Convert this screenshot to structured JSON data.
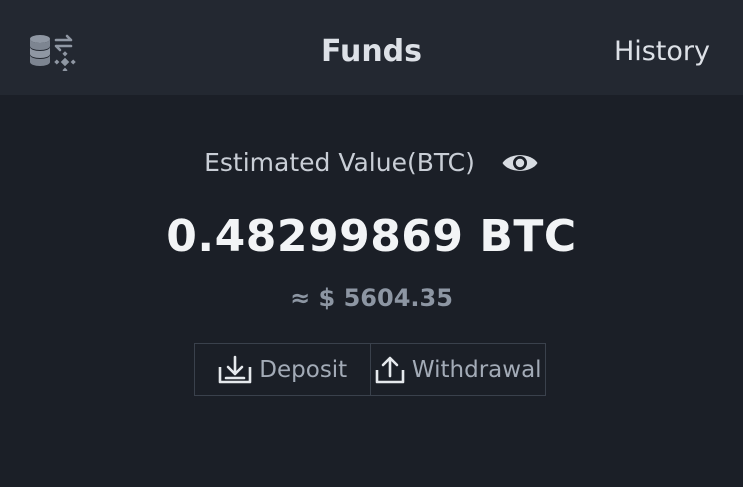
{
  "header": {
    "title": "Funds",
    "history_label": "History",
    "left_icon": "coins-exchange-icon"
  },
  "balance": {
    "estimated_label": "Estimated Value(BTC)",
    "visibility_icon": "eye-icon",
    "btc_value": "0.48299869 BTC",
    "usd_value": "≈ $ 5604.35"
  },
  "actions": {
    "deposit_label": "Deposit",
    "deposit_icon": "download-tray-icon",
    "withdrawal_label": "Withdrawal",
    "withdrawal_icon": "upload-tray-icon"
  },
  "colors": {
    "background": "#1b1f27",
    "header_background": "#232831",
    "primary_text": "#f2f4f6",
    "muted_text": "#8d96a3",
    "border": "#3a414c"
  }
}
